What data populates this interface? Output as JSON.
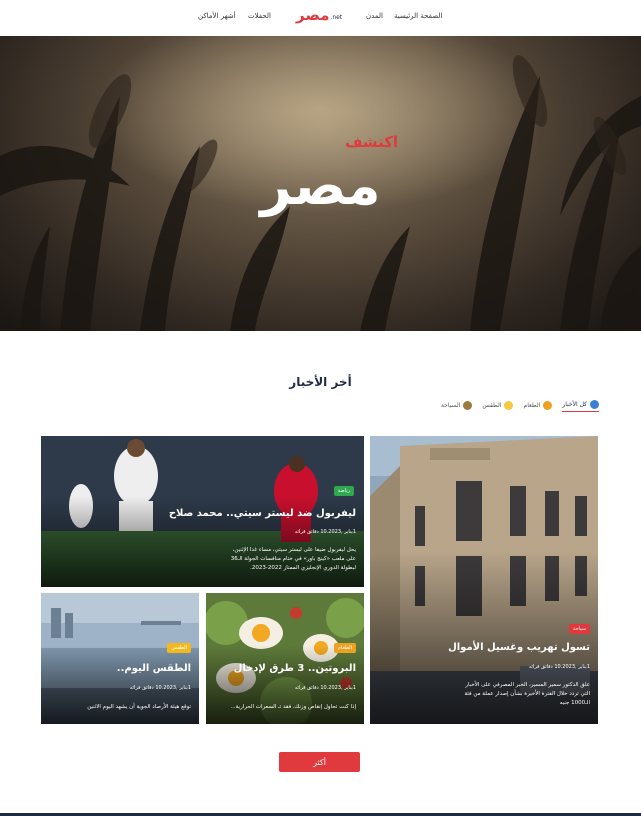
{
  "header": {
    "nav": {
      "home": "الصفحة الرئيسية",
      "cities": "المدن",
      "events": "الحفلات",
      "places": "أشهر الأماكن"
    },
    "logo_text": "مصر",
    "logo_suffix": ".net"
  },
  "hero": {
    "subtitle": "اكتشف",
    "title": "مصر"
  },
  "news": {
    "title": "أخر الأخبار",
    "tabs": [
      {
        "label": "كل الأخبار",
        "icon": "all-news-icon"
      },
      {
        "label": "الطعام",
        "icon": "food-icon"
      },
      {
        "label": "الطقس",
        "icon": "weather-icon"
      },
      {
        "label": "السياحة",
        "icon": "tourism-icon"
      }
    ],
    "cards": [
      {
        "badge": "سياحة",
        "title": "تسول تهريب وغسيل الأموال",
        "meta": "1يناير ,10.2023 دقائق قرائه",
        "desc": [
          "علق الدكتور سمير المسير، الخبر المصرفي على الأخبار",
          "التي تردد خلال الفترة الأخيرة بشأن إصدار عملة من فئة",
          "الـ1000 جنيه"
        ]
      },
      {
        "badge": "رياضة",
        "title": "ليفربول ضد ليستر سيتي.. محمد صلاح",
        "meta": "1يناير ,10.2023 دقائق قرائه",
        "desc": [
          "يحل ليفربول ضيفا على ليستر سيتي، مساء غدا الإثنين،",
          "على ملعب «كينج باور» في ختام منافسات الجولة الـ36",
          "لبطولة الدوري الإنجليزي الممتاز 2022-2023."
        ]
      },
      {
        "badge": "الطعام",
        "title": "البروتين.. 3 طرق لإدخال",
        "meta": "1يناير ,10.2023 دقائق قرائه",
        "desc": [
          "إذا كنت تحاول إنقاص وزنك، فقد تـ السعرات الحرارية..."
        ]
      },
      {
        "badge": "الطقس",
        "title": "الطقس اليوم..",
        "meta": "1يناير ,10.2023 دقائق قرائه",
        "desc": [
          "توقع هيئة الأرصاد الجوية أن يشهد اليوم الاثنين"
        ]
      }
    ],
    "more_label": "أكثر"
  },
  "colors": {
    "accent": "#e03a3e",
    "navy": "#1f2a44",
    "badge_green": "#2fa84f",
    "badge_orange": "#f0a020",
    "badge_yellow": "#f2b81c"
  }
}
